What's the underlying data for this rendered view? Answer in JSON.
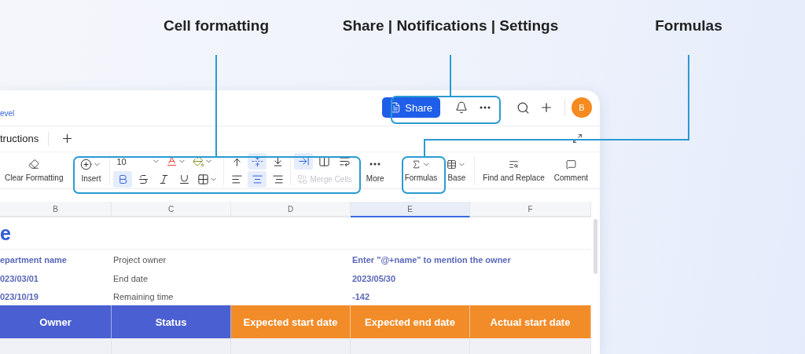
{
  "callouts": [
    {
      "label": "Cell formatting"
    },
    {
      "label": "Share | Notifications | Settings"
    },
    {
      "label": "Formulas"
    }
  ],
  "topbar": {
    "breadcrumb": "evel",
    "share": "Share",
    "avatar": "B"
  },
  "sheet_tabs": [
    {
      "label": "tructions",
      "selected": true
    }
  ],
  "toolbar": {
    "clear_formatting": "Clear Formatting",
    "insert": "Insert",
    "font_size": "10",
    "text_styles": [
      {
        "kind": "bold",
        "selected": true
      },
      {
        "kind": "strikethrough",
        "selected": false
      },
      {
        "kind": "italic",
        "selected": false
      },
      {
        "kind": "underline",
        "selected": false
      }
    ],
    "vertical_align": [
      {
        "kind": "top",
        "selected": false
      },
      {
        "kind": "middle",
        "selected": true
      },
      {
        "kind": "bottom",
        "selected": false
      }
    ],
    "horizontal_align": [
      {
        "kind": "left",
        "selected": false
      },
      {
        "kind": "center",
        "selected": true
      },
      {
        "kind": "right",
        "selected": false
      }
    ],
    "wrap": [
      {
        "kind": "overflow",
        "selected": true
      },
      {
        "kind": "clip",
        "selected": false
      },
      {
        "kind": "wrap",
        "selected": false
      }
    ],
    "merge_cells": {
      "label": "Merge Cells",
      "disabled": true
    },
    "more": "More",
    "formulas": "Formulas",
    "base": "Base",
    "find_replace": "Find and Replace",
    "comment": "Comment"
  },
  "columns": [
    {
      "label": "B",
      "selected": false
    },
    {
      "label": "C",
      "selected": false
    },
    {
      "label": "D",
      "selected": false
    },
    {
      "label": "E",
      "selected": true
    },
    {
      "label": "F",
      "selected": false
    }
  ],
  "title": "e",
  "info_rows": [
    {
      "b": "epartment name",
      "c": "Project owner",
      "e": "Enter \"@+name\" to mention the owner"
    },
    {
      "b": "023/03/01",
      "c": "End date",
      "e": "2023/05/30"
    },
    {
      "b": "023/10/19",
      "c": "Remaining time",
      "e": "-142"
    }
  ],
  "header_row": [
    {
      "label": "Owner",
      "color": "#4a5fd1"
    },
    {
      "label": "Status",
      "color": "#4a5fd1"
    },
    {
      "label": "Expected start date",
      "color": "#f28c28"
    },
    {
      "label": "Expected end date",
      "color": "#f28c28"
    },
    {
      "label": "Actual start date",
      "color": "#f28c28"
    }
  ]
}
